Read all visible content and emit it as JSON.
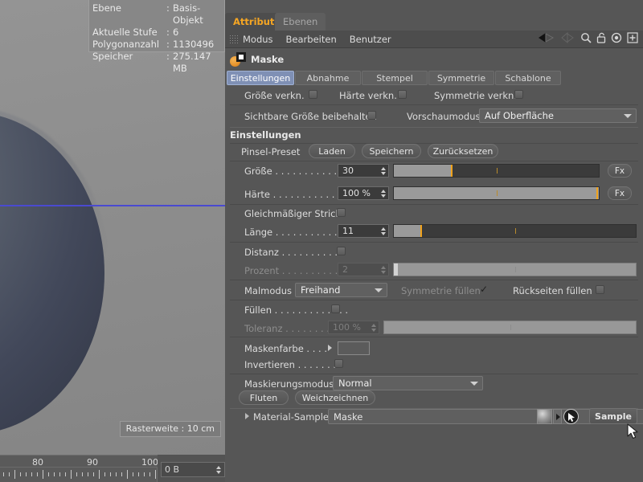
{
  "viewport": {
    "raster_label": "Rasterweite : 10 cm",
    "info": {
      "rows": [
        {
          "key": "Ebene",
          "sep": ":",
          "value": "Basis-Objekt"
        },
        {
          "key": "Aktuelle Stufe",
          "sep": ":",
          "value": "6"
        },
        {
          "key": "Polygonanzahl",
          "sep": ":",
          "value": "1130496"
        },
        {
          "key": "Speicher",
          "sep": ":",
          "value": "275.147 MB"
        }
      ]
    },
    "ruler": {
      "labels": [
        "80",
        "90",
        "100"
      ]
    },
    "bytes_field": {
      "value": "0 B"
    }
  },
  "panel": {
    "dock_tabs": [
      {
        "label": "Attribute",
        "active": true
      },
      {
        "label": "Ebenen",
        "active": false
      }
    ],
    "menu": {
      "items": [
        "Modus",
        "Bearbeiten",
        "Benutzer"
      ],
      "icons": [
        "back-arrow-icon",
        "forward-arrow-icon",
        "search-icon",
        "lock-icon",
        "target-icon",
        "plus-icon"
      ]
    },
    "object": {
      "name": "Maske",
      "icon": "mask-object-icon"
    },
    "sub_tabs": [
      {
        "label": "Einstellungen",
        "active": true
      },
      {
        "label": "Abnahme",
        "active": false
      },
      {
        "label": "Stempel",
        "active": false
      },
      {
        "label": "Symmetrie",
        "active": false
      },
      {
        "label": "Schablone",
        "active": false
      }
    ],
    "link_row": {
      "size_link": "Größe verkn.",
      "hardness_link": "Härte verkn.",
      "symmetry_link": "Symmetrie verkn."
    },
    "preview_row": {
      "keep_visible_size": "Sichtbare Größe beibehalten",
      "preview_mode_label": "Vorschaumodus",
      "preview_mode_value": "Auf Oberfläche"
    },
    "settings": {
      "header": "Einstellungen",
      "preset_label": "Pinsel-Preset",
      "preset_buttons": [
        "Laden",
        "Speichern",
        "Zurücksetzen"
      ],
      "size": {
        "label": "Größe . . . . . . . . . . . . .",
        "value": "30",
        "fx": "Fx",
        "fill_pct": 28
      },
      "hardness": {
        "label": "Härte . . . . . . . . . . . . .",
        "value": "100 %",
        "fx": "Fx",
        "fill_pct": 100
      }
    },
    "stroke": {
      "even_stroke_label": "Gleichmäßiger Strich",
      "length": {
        "label": "Länge . . . . . . . . . . . . .",
        "value": "11",
        "fill_pct": 11
      }
    },
    "distance": {
      "distance_label": "Distanz . . . . . . . . . . .",
      "percent": {
        "label": "Prozent . . . . . . . . . . . .",
        "value": "2",
        "fill_pct": 2
      }
    },
    "paint": {
      "mode_label": "Malmodus",
      "mode_value": "Freihand",
      "fill_symmetry_label": "Symmetrie füllen",
      "fill_backfaces_label": "Rückseiten füllen",
      "fill_label": "Füllen . . . . . . . . . . . . .",
      "tolerance": {
        "label": "Toleranz . . . . . . . . .",
        "value": "100 %",
        "fill_pct": 100
      }
    },
    "mask": {
      "color_label": "Maskenfarbe . . . .",
      "invert_label": "Invertieren  . . . . . . .",
      "mode_label": "Maskierungsmodus",
      "mode_value": "Normal",
      "buttons": [
        "Fluten",
        "Weichzeichnen"
      ]
    },
    "material_sample": {
      "label": "Material-Sample",
      "value": "Maske",
      "button": "Sample"
    }
  }
}
